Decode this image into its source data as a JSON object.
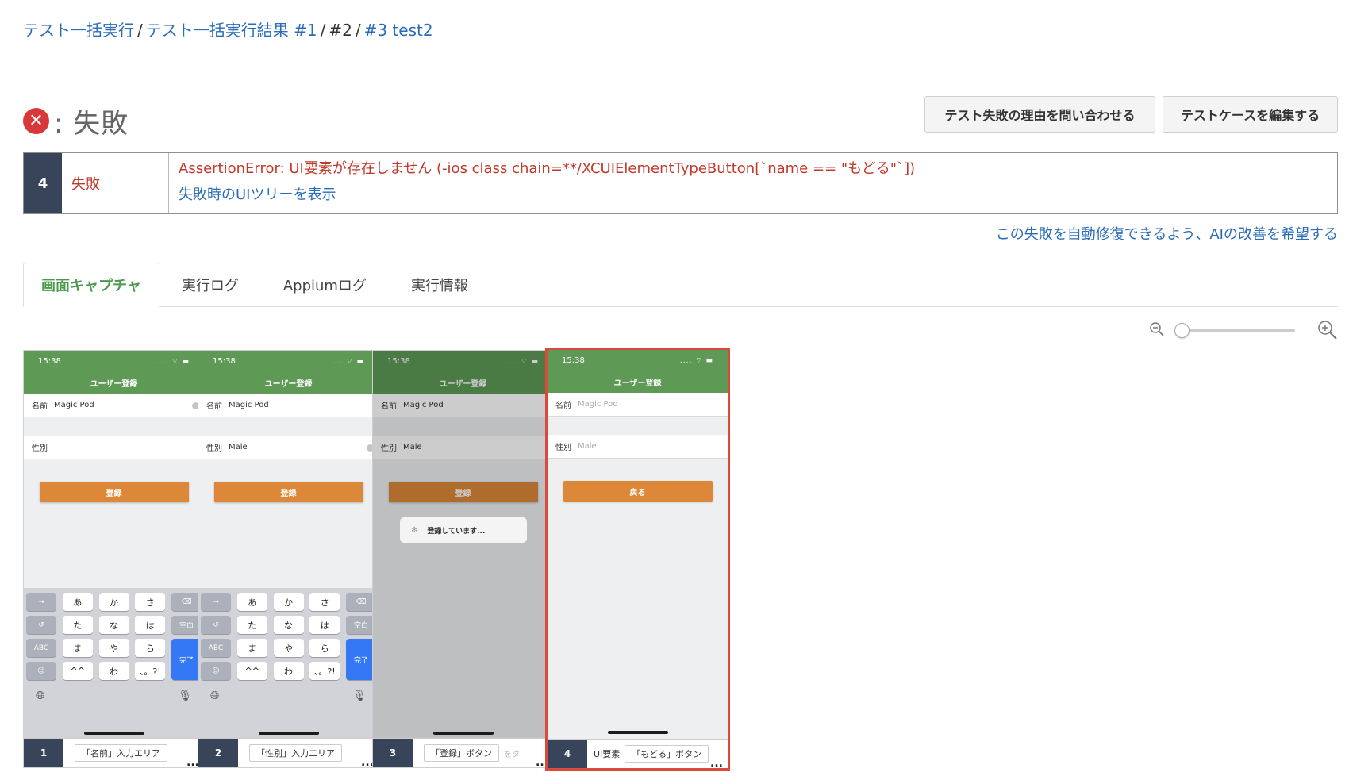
{
  "breadcrumb": {
    "items": [
      {
        "label": "テスト一括実行"
      },
      {
        "label": "テスト一括実行結果 #1"
      },
      {
        "label": "#2"
      },
      {
        "label": "#3 test2"
      }
    ],
    "separator": "/"
  },
  "status": {
    "icon": "x-circle-icon",
    "text": ": 失敗",
    "color": "#d9383a"
  },
  "actions": {
    "inquire_label": "テスト失敗の理由を問い合わせる",
    "edit_label": "テストケースを編集する"
  },
  "error": {
    "step_number": "4",
    "status_label": "失敗",
    "message": "AssertionError: UI要素が存在しません (-ios class chain=**/XCUIElementTypeButton[`name == \"もどる\"`])",
    "tree_link": "失敗時のUIツリーを表示"
  },
  "ai_request_link": "この失敗を自動修復できるよう、AIの改善を希望する",
  "tabs": [
    {
      "label": "画面キャプチャ",
      "active": true
    },
    {
      "label": "実行ログ",
      "active": false
    },
    {
      "label": "Appiumログ",
      "active": false
    },
    {
      "label": "実行情報",
      "active": false
    }
  ],
  "zoom": {
    "zoom_out_icon": "zoom-out-icon",
    "zoom_in_icon": "zoom-in-icon",
    "level": 0
  },
  "colors": {
    "link": "#2b6cb8",
    "error": "#c0392b",
    "active_tab": "#4a9a4d",
    "nav_green": "#5e9a55",
    "app_button": "#dd8838",
    "step_badge": "#37445a",
    "selected_border": "#d9493c"
  },
  "screenshots": [
    {
      "step": "1",
      "phone": {
        "time": "15:38",
        "title": "ユーザー登録",
        "name_label": "名前",
        "name_value": "Magic Pod",
        "gender_label": "性別",
        "gender_value": "",
        "button_label": "登録"
      },
      "keyboard": {
        "rows": [
          [
            "→",
            "あ",
            "か",
            "さ",
            "⌫"
          ],
          [
            "↺",
            "た",
            "な",
            "は",
            "空白"
          ],
          [
            "ABC",
            "ま",
            "や",
            "ら",
            "完了"
          ],
          [
            "☺",
            "^^",
            "わ",
            "、。?!",
            ""
          ]
        ],
        "globe": "globe-icon",
        "mic": "mic-icon"
      },
      "caption_prefix": "",
      "caption": "「名前」入力エリア",
      "caption_extra": "",
      "more": "..."
    },
    {
      "step": "2",
      "phone": {
        "time": "15:38",
        "title": "ユーザー登録",
        "name_label": "名前",
        "name_value": "Magic Pod",
        "gender_label": "性別",
        "gender_value": "Male",
        "button_label": "登録"
      },
      "keyboard": {
        "rows": [
          [
            "→",
            "あ",
            "か",
            "さ",
            "⌫"
          ],
          [
            "↺",
            "た",
            "な",
            "は",
            "空白"
          ],
          [
            "ABC",
            "ま",
            "や",
            "ら",
            "完了"
          ],
          [
            "☺",
            "^^",
            "わ",
            "、。?!",
            ""
          ]
        ],
        "globe": "globe-icon",
        "mic": "mic-icon"
      },
      "caption_prefix": "",
      "caption": "「性別」入力エリア",
      "caption_extra": "",
      "more": "..."
    },
    {
      "step": "3",
      "phone": {
        "time": "15:38",
        "title": "ユーザー登録",
        "name_label": "名前",
        "name_value": "Magic Pod",
        "gender_label": "性別",
        "gender_value": "Male",
        "button_label": "登録",
        "hud_text": "登録しています..."
      },
      "caption_prefix": "",
      "caption": "「登録」ボタン",
      "caption_extra": "をタ",
      "more": "..."
    },
    {
      "step": "4",
      "phone": {
        "time": "15:38",
        "title": "ユーザー登録",
        "name_label": "名前",
        "name_value": "Magic Pod",
        "gender_label": "性別",
        "gender_value": "Male",
        "button_label": "戻る"
      },
      "caption_prefix": "UI要素",
      "caption": "「もどる」ボタン",
      "caption_extra": "",
      "more": "..."
    }
  ]
}
